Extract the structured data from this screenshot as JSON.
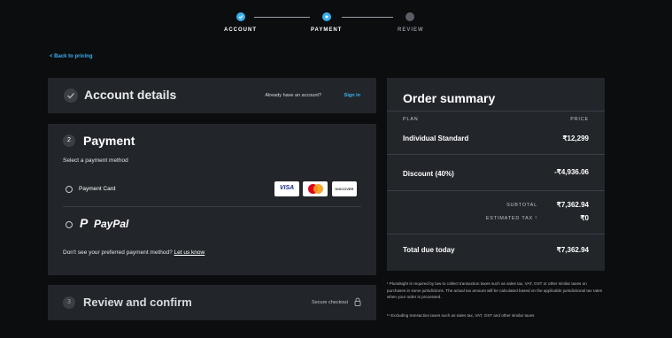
{
  "stepper": {
    "steps": [
      {
        "label": "ACCOUNT",
        "state": "done"
      },
      {
        "label": "PAYMENT",
        "state": "active"
      },
      {
        "label": "REVIEW",
        "state": "todo"
      }
    ]
  },
  "back_link": "< Back to pricing",
  "account": {
    "title": "Account details",
    "have_account": "Already have an account?",
    "sign_in": "Sign in"
  },
  "payment": {
    "step_number": "2",
    "title": "Payment",
    "subtitle": "Select a payment method",
    "card_label": "Payment Card",
    "cards": [
      "VISA",
      "mastercard",
      "DISCOVER"
    ],
    "paypal_label": "PayPal",
    "other_text": "Don't see your preferred payment method?",
    "other_link": "Let us know"
  },
  "review": {
    "step_number": "3",
    "title": "Review and confirm",
    "secure": "Secure checkout"
  },
  "summary": {
    "title": "Order summary",
    "plan_header": "PLAN",
    "price_header": "PRICE",
    "plan_name": "Individual Standard",
    "plan_price": "₹12,299",
    "discount_label": "Discount (40%)",
    "discount_value": "-₹4,936.06",
    "subtotal_label": "SUBTOTAL",
    "subtotal_value": "₹7,362.94",
    "tax_label": "ESTIMATED TAX ¹",
    "tax_value": "₹0",
    "total_label": "Total due today",
    "total_value": "₹7,362.94"
  },
  "footnotes": {
    "note1": "¹  Pluralsight is required by law to collect transaction taxes such as sales tax, VAT, GST or other similar taxes on purchases in some jurisdictions. The actual tax amount will be calculated based on the applicable jurisdictional tax rates when your order is processed.",
    "note2": "¹¹  Excluding transaction taxes such as sales tax, VAT, GST and other similar taxes"
  },
  "colors": {
    "accent": "#3bb0ee",
    "panel": "#22262b",
    "background": "#0b0d0f"
  }
}
